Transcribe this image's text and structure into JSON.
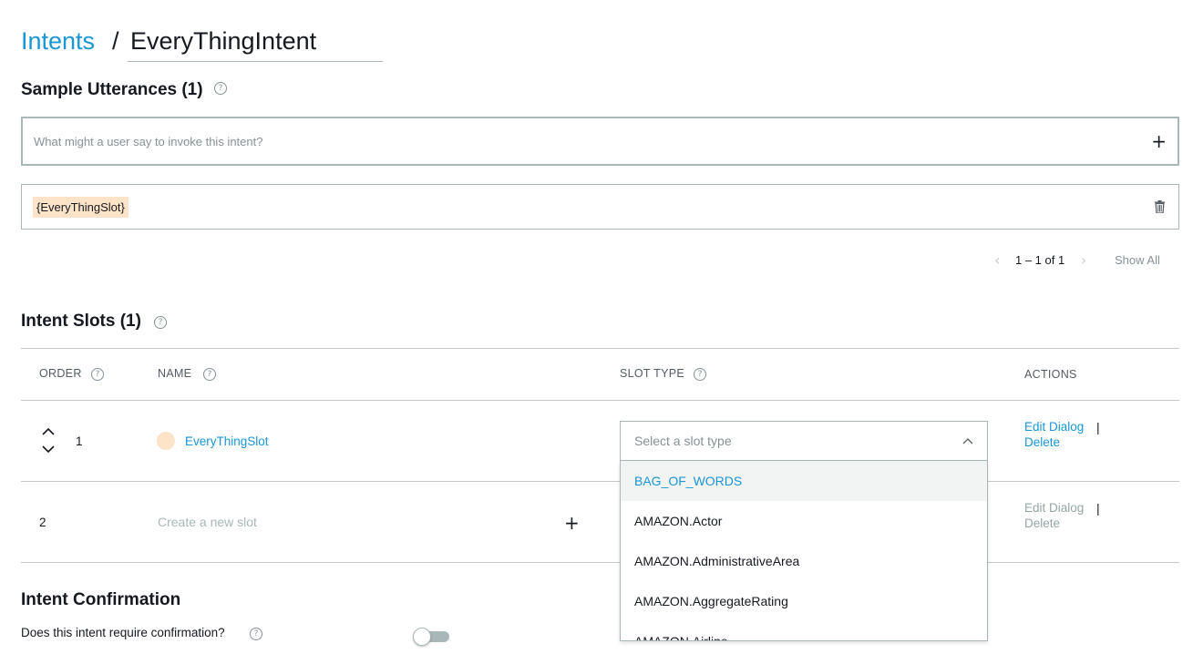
{
  "breadcrumb": {
    "parent": "Intents",
    "separator": "/",
    "current": "EveryThingIntent"
  },
  "utterances": {
    "title": "Sample Utterances (1)",
    "placeholder": "What might a user say to invoke this intent?",
    "items": [
      {
        "token": "{EveryThingSlot}"
      }
    ],
    "pager": {
      "range": "1 – 1 of 1",
      "show_all": "Show All"
    }
  },
  "slots": {
    "title": "Intent Slots (1)",
    "columns": {
      "order": "ORDER",
      "name": "NAME",
      "slot_type": "SLOT TYPE",
      "actions": "ACTIONS"
    },
    "rows": [
      {
        "order": "1",
        "name": "EveryThingSlot",
        "edit": "Edit Dialog",
        "sep": "|",
        "delete": "Delete"
      },
      {
        "order": "2",
        "placeholder": "Create a new slot",
        "edit": "Edit Dialog",
        "sep": "|",
        "delete": "Delete"
      }
    ],
    "slot_type_select": {
      "placeholder": "Select a slot type",
      "options": [
        "BAG_OF_WORDS",
        "AMAZON.Actor",
        "AMAZON.AdministrativeArea",
        "AMAZON.AggregateRating",
        "AMAZON.Airline"
      ]
    }
  },
  "confirmation": {
    "title": "Intent Confirmation",
    "question": "Does this intent require confirmation?",
    "toggle_on": false
  },
  "icons": {
    "help": "question-circle-icon",
    "add": "plus-icon",
    "trash": "trash-icon",
    "sort_up": "chevron-up-icon",
    "sort_down": "chevron-down-icon",
    "prev": "chevron-left-icon",
    "next": "chevron-right-icon",
    "dropdown": "chevron-up-icon"
  },
  "colors": {
    "accent": "#1a96d6",
    "slot_highlight": "#fde3c8",
    "muted": "#879196"
  }
}
